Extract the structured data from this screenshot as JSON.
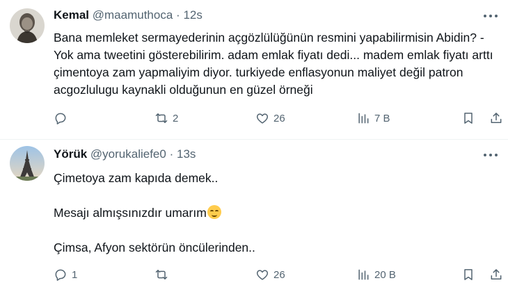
{
  "tweets": [
    {
      "name": "Kemal",
      "handle": "@maamuthoca",
      "separator": "·",
      "time": "12s",
      "more_icon": "more-horizontal-icon",
      "lines": [
        "Bana memleket sermayederinin açgözlülüğünün resmini yapabilirmisin Abidin? -Yok ama tweetini gösterebilirim. adam emlak fiyatı dedi... madem emlak fiyatı arttı çimentoya zam yapmaliyim diyor. turkiyede enflasyonun maliyet değil patron acgozlulugu kaynakli olduğunun en güzel örneği"
      ],
      "stats": {
        "replies": "",
        "retweets": "2",
        "likes": "26",
        "views": "7 B"
      }
    },
    {
      "name": "Yörük",
      "handle": "@yorukaliefe0",
      "separator": "·",
      "time": "13s",
      "more_icon": "more-horizontal-icon",
      "lines": [
        "Çimetoya zam kapıda demek..",
        "Mesajı almışsınızdır umarım",
        "Çimsa, Afyon sektörün öncülerinden.."
      ],
      "emoji": "relieved-face-emoji",
      "stats": {
        "replies": "1",
        "retweets": "",
        "likes": "26",
        "views": "20 B"
      }
    }
  ],
  "colors": {
    "text": "#0f1419",
    "muted": "#536471",
    "divider": "#eff3f4",
    "emoji": "#ffcc4d"
  }
}
